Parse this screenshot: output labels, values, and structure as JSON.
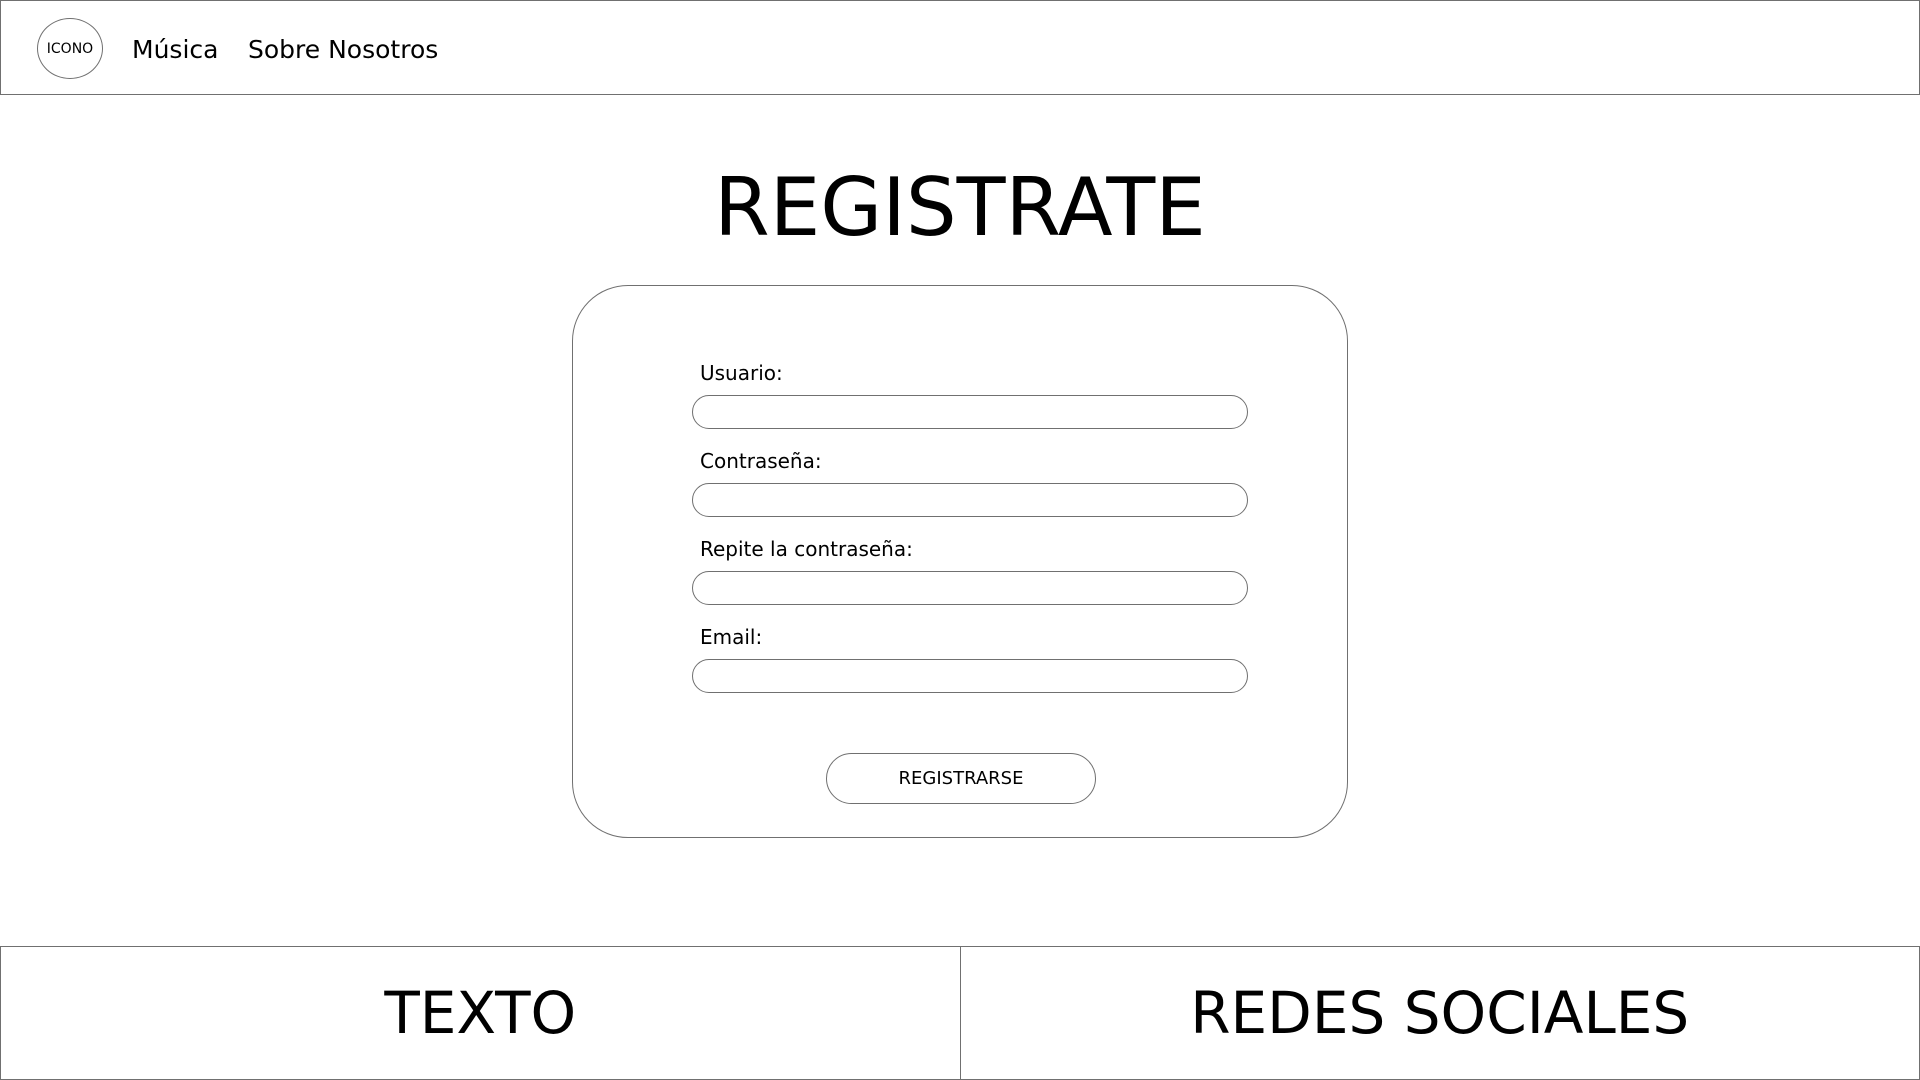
{
  "header": {
    "logo_label": "ICONO",
    "nav": [
      {
        "label": "Música"
      },
      {
        "label": "Sobre Nosotros"
      }
    ]
  },
  "main": {
    "title": "REGISTRATE",
    "form": {
      "fields": [
        {
          "label": "Usuario:",
          "value": ""
        },
        {
          "label": "Contraseña:",
          "value": ""
        },
        {
          "label": "Repite la contraseña:",
          "value": ""
        },
        {
          "label": "Email:",
          "value": ""
        }
      ],
      "submit_label": "REGISTRARSE"
    }
  },
  "footer": {
    "left_text": "TEXTO",
    "right_text": "REDES SOCIALES"
  },
  "colors": {
    "background": "#ffffff",
    "border": "#707070",
    "text": "#000000"
  }
}
